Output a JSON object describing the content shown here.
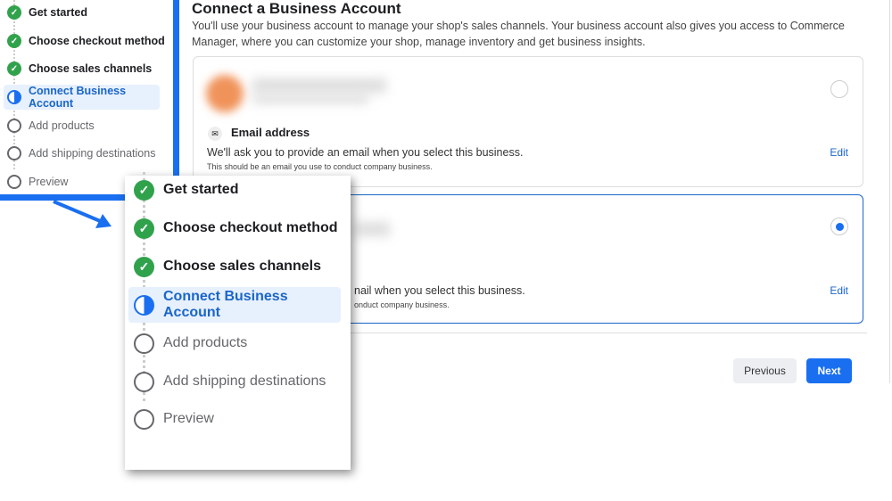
{
  "steps": [
    {
      "label": "Get started",
      "state": "done"
    },
    {
      "label": "Choose checkout method",
      "state": "done"
    },
    {
      "label": "Choose sales channels",
      "state": "done"
    },
    {
      "label": "Connect Business Account",
      "state": "current"
    },
    {
      "label": "Add products",
      "state": "todo"
    },
    {
      "label": "Add shipping destinations",
      "state": "todo"
    },
    {
      "label": "Preview",
      "state": "todo"
    }
  ],
  "main": {
    "title": "Connect a Business Account",
    "description": "You'll use your business account to manage your shop's sales channels. Your business account also gives you access to Commerce Manager, where you can customize your shop, manage inventory and get business insights.",
    "card1": {
      "email_title": "Email address",
      "line1": "We'll ask you to provide an email when you select this business.",
      "line2": "This should be an email you use to conduct company business.",
      "edit": "Edit",
      "selected": false
    },
    "card2": {
      "line1": "nail when you select this business.",
      "line2": "onduct company business.",
      "edit": "Edit",
      "selected": true
    },
    "previous": "Previous",
    "next": "Next"
  },
  "colors": {
    "accent": "#1a6ff0",
    "done": "#31a24c"
  }
}
